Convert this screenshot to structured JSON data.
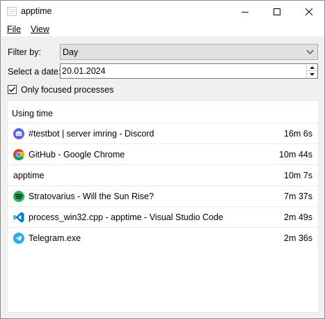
{
  "window": {
    "title": "apptime"
  },
  "menu": {
    "file": "File",
    "view": "View"
  },
  "filter": {
    "label": "Filter by:",
    "value": "Day"
  },
  "date": {
    "label": "Select a date:",
    "value": "20.01.2024"
  },
  "focused": {
    "label": "Only focused processes",
    "checked": true
  },
  "list": {
    "header": "Using time",
    "rows": [
      {
        "name": "#testbot | server imring - Discord",
        "time": "16m 6s",
        "icon": "discord-icon"
      },
      {
        "name": "GitHub - Google Chrome",
        "time": "10m 44s",
        "icon": "chrome-icon"
      },
      {
        "name": "apptime",
        "time": "10m 7s",
        "icon": ""
      },
      {
        "name": "Stratovarius - Will the Sun Rise?",
        "time": "7m 37s",
        "icon": "spotify-icon"
      },
      {
        "name": "process_win32.cpp - apptime - Visual Studio Code",
        "time": "2m 49s",
        "icon": "vscode-icon"
      },
      {
        "name": "Telegram.exe",
        "time": "2m 36s",
        "icon": "telegram-icon"
      }
    ]
  },
  "colors": {
    "discord": "#5865F2",
    "chrome_red": "#DB4437",
    "chrome_yellow": "#F4B400",
    "chrome_green": "#0F9D58",
    "chrome_blue": "#4285F4",
    "spotify": "#1DB954",
    "vscode": "#0078D4",
    "telegram": "#2AABEE"
  }
}
